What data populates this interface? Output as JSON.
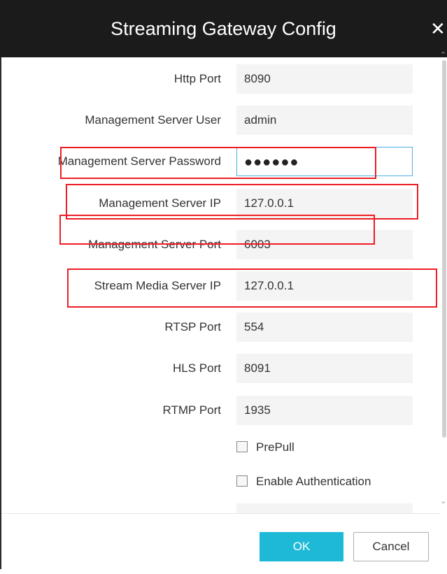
{
  "window": {
    "title": "Streaming Gateway Config",
    "close_glyph": "✕"
  },
  "form": {
    "fields": [
      {
        "label": "Http Port",
        "value": "8090"
      },
      {
        "label": "Management Server User",
        "value": "admin"
      },
      {
        "label": "Management Server Password",
        "value": "●●●●●●"
      },
      {
        "label": "Management Server IP",
        "value": "127.0.0.1"
      },
      {
        "label": "Management Server Port",
        "value": "6003"
      },
      {
        "label": "Stream Media Server IP",
        "value": "127.0.0.1"
      },
      {
        "label": "RTSP Port",
        "value": "554"
      },
      {
        "label": "HLS Port",
        "value": "8091"
      },
      {
        "label": "RTMP Port",
        "value": "1935"
      }
    ],
    "checkboxes": [
      {
        "label": "PrePull",
        "checked": false
      },
      {
        "label": "Enable Authentication",
        "checked": false
      }
    ]
  },
  "buttons": {
    "ok": "OK",
    "cancel": "Cancel"
  },
  "colors": {
    "titlebar": "#1b1b1b",
    "accent_ok": "#1fb9d8",
    "focus_border": "#4bb0e6",
    "highlight": "#ee1c25"
  }
}
